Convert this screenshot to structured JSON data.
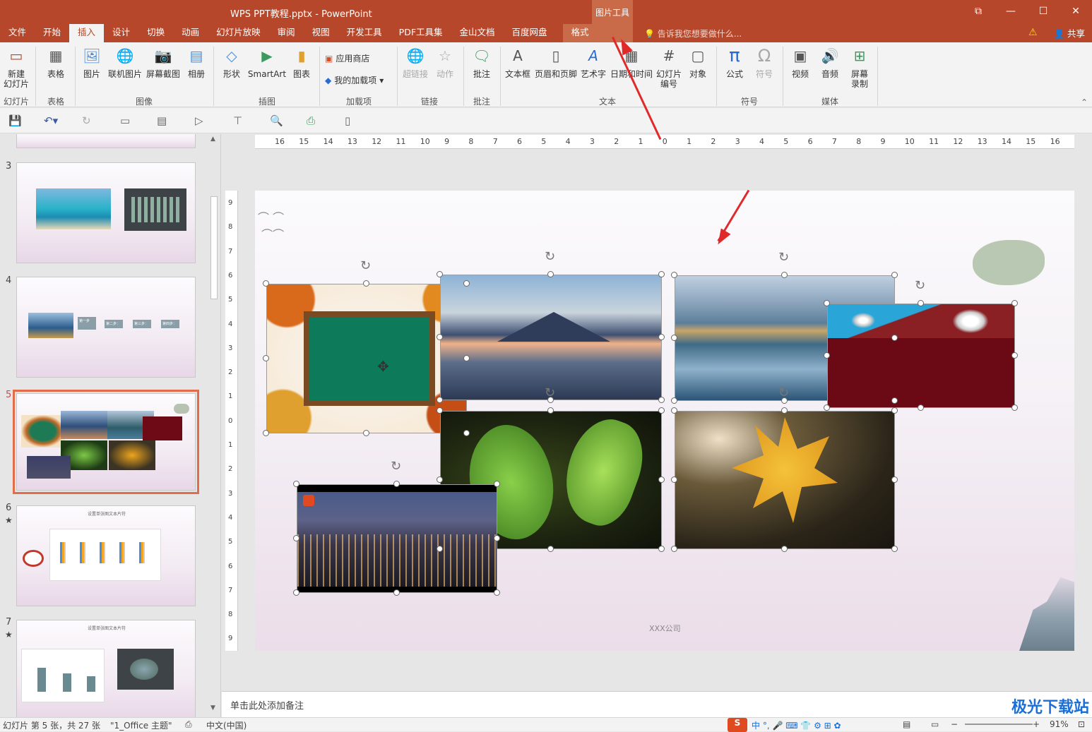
{
  "window": {
    "title": "WPS PPT教程.pptx - PowerPoint",
    "context_group": "图片工具",
    "share": "共享"
  },
  "tabs": [
    "文件",
    "开始",
    "插入",
    "设计",
    "切换",
    "动画",
    "幻灯片放映",
    "审阅",
    "视图",
    "开发工具",
    "PDF工具集",
    "金山文档",
    "百度网盘",
    "格式"
  ],
  "active_tab": "插入",
  "tell_me": "告诉我您想要做什么...",
  "ribbon": {
    "new_slide": "新建\n幻灯片",
    "groups": [
      "幻灯片",
      "表格",
      "图像",
      "插图",
      "加载项",
      "链接",
      "批注",
      "文本",
      "符号",
      "媒体"
    ],
    "buttons": {
      "table": "表格",
      "picture": "图片",
      "online_picture": "联机图片",
      "screenshot": "屏幕截图",
      "album": "相册",
      "shapes": "形状",
      "smartart": "SmartArt",
      "chart": "图表",
      "app_store": "应用商店",
      "my_addins": "我的加载项",
      "hyperlink": "超链接",
      "action": "动作",
      "comment": "批注",
      "textbox": "文本框",
      "header_footer": "页眉和页脚",
      "wordart": "艺术字",
      "datetime": "日期和时间",
      "slide_number": "幻灯片\n编号",
      "object": "对象",
      "equation": "公式",
      "symbol": "符号",
      "video": "视频",
      "audio": "音频",
      "screen_record": "屏幕\n录制"
    }
  },
  "thumbnails": [
    {
      "num": "3",
      "star": false
    },
    {
      "num": "4",
      "star": false,
      "steps": [
        "第一步",
        "第二步：",
        "第三步：",
        "第四步："
      ]
    },
    {
      "num": "5",
      "star": false,
      "selected": true
    },
    {
      "num": "6",
      "star": true,
      "title": "设置单张图文本片符"
    },
    {
      "num": "7",
      "star": true,
      "title": "设置单张图文本片符"
    }
  ],
  "slide": {
    "footer": "XXX公司"
  },
  "notes_placeholder": "单击此处添加备注",
  "status": {
    "slide_info": "幻灯片 第 5 张，共 27 张",
    "theme": "\"1_Office 主题\"",
    "language": "中文(中国)",
    "zoom": "91%"
  },
  "ruler_h": [
    "16",
    "15",
    "14",
    "13",
    "12",
    "11",
    "10",
    "9",
    "8",
    "7",
    "6",
    "5",
    "4",
    "3",
    "2",
    "1",
    "0",
    "1",
    "2",
    "3",
    "4",
    "5",
    "6",
    "7",
    "8",
    "9",
    "10",
    "11",
    "12",
    "13",
    "14",
    "15",
    "16"
  ],
  "ruler_v": [
    "9",
    "8",
    "7",
    "6",
    "5",
    "4",
    "3",
    "2",
    "1",
    "0",
    "1",
    "2",
    "3",
    "4",
    "5",
    "6",
    "7",
    "8",
    "9"
  ],
  "watermark": "极光下载站"
}
